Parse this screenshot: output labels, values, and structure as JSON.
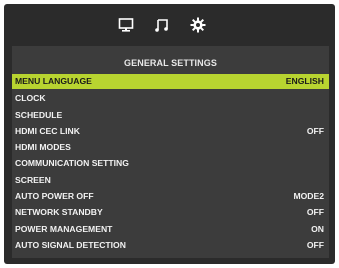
{
  "tabs": [
    {
      "name": "picture",
      "icon": "monitor-icon",
      "active": false
    },
    {
      "name": "audio",
      "icon": "music-note-icon",
      "active": false
    },
    {
      "name": "settings",
      "icon": "gear-icon",
      "active": true
    }
  ],
  "panel": {
    "title": "GENERAL SETTINGS"
  },
  "menu": {
    "selected_index": 0,
    "highlight_color": "#b8d430",
    "items": [
      {
        "label": "MENU LANGUAGE",
        "value": "ENGLISH"
      },
      {
        "label": "CLOCK",
        "value": ""
      },
      {
        "label": "SCHEDULE",
        "value": ""
      },
      {
        "label": "HDMI CEC LINK",
        "value": "OFF"
      },
      {
        "label": "HDMI MODES",
        "value": ""
      },
      {
        "label": "COMMUNICATION SETTING",
        "value": ""
      },
      {
        "label": "SCREEN",
        "value": ""
      },
      {
        "label": "AUTO POWER OFF",
        "value": "MODE2"
      },
      {
        "label": "NETWORK STANDBY",
        "value": "OFF"
      },
      {
        "label": "POWER MANAGEMENT",
        "value": "ON"
      },
      {
        "label": "AUTO SIGNAL DETECTION",
        "value": "OFF"
      }
    ]
  }
}
